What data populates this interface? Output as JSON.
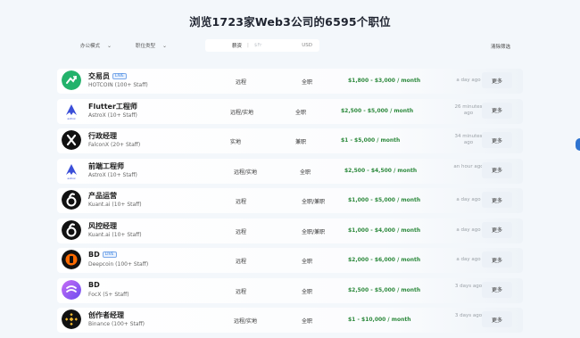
{
  "page": {
    "title": "浏览1723家Web3公司的6595个职位"
  },
  "filters": {
    "work_mode": "办公模式",
    "job_type": "职位类型",
    "salary_label": "薪资",
    "salary_placeholder": "$Fr",
    "currency": "USD",
    "clear": "清除筛选"
  },
  "jobs": [
    {
      "title": "交易员",
      "badge": "LIVE",
      "company": "HOTCOIN (100+ Staff)",
      "location": "远程",
      "type": "全职",
      "salary": "$1,800 - $3,000 / month",
      "time": "a day ago",
      "more": "更多"
    },
    {
      "title": "Flutter工程师",
      "badge": "",
      "company": "AstroX (10+ Staff)",
      "location": "远程/实地",
      "type": "全职",
      "salary": "$2,500 - $5,000 / month",
      "time": "26 minutes ago",
      "more": "更多"
    },
    {
      "title": "行政经理",
      "badge": "",
      "company": "FalconX (20+ Staff)",
      "location": "实地",
      "type": "兼职",
      "salary": "$1 - $5,000 / month",
      "time": "34 minutes ago",
      "more": "更多"
    },
    {
      "title": "前端工程师",
      "badge": "",
      "company": "AstroX (10+ Staff)",
      "location": "远程/实地",
      "type": "全职",
      "salary": "$2,500 - $4,500 / month",
      "time": "an hour ago",
      "more": "更多"
    },
    {
      "title": "产品运营",
      "badge": "",
      "company": "Kuant.ai (10+ Staff)",
      "location": "远程",
      "type": "全职/兼职",
      "salary": "$1,000 - $5,000 / month",
      "time": "a day ago",
      "more": "更多"
    },
    {
      "title": "风控经理",
      "badge": "",
      "company": "Kuant.ai (10+ Staff)",
      "location": "远程",
      "type": "全职/兼职",
      "salary": "$1,000 - $4,000 / month",
      "time": "a day ago",
      "more": "更多"
    },
    {
      "title": "BD",
      "badge": "LIVE",
      "company": "Deepcoin (100+ Staff)",
      "location": "远程",
      "type": "全职",
      "salary": "$2,000 - $6,000 / month",
      "time": "a day ago",
      "more": "更多"
    },
    {
      "title": "BD",
      "badge": "",
      "company": "FocX (5+ Staff)",
      "location": "远程",
      "type": "全职",
      "salary": "$2,500 - $5,000 / month",
      "time": "3 days ago",
      "more": "更多"
    },
    {
      "title": "创作者经理",
      "badge": "",
      "company": "Binance (100+ Staff)",
      "location": "远程/实地",
      "type": "全职",
      "salary": "$1 - $10,000 / month",
      "time": "3 days ago",
      "more": "更多"
    }
  ],
  "colors": {
    "salary": "#2e8a3e",
    "badge": "#2f7de1",
    "hotcoin": "#23b26b",
    "deepcoin": "#ff6a00",
    "focx": "#8a5cf6",
    "binance": "#f3ba2f"
  }
}
